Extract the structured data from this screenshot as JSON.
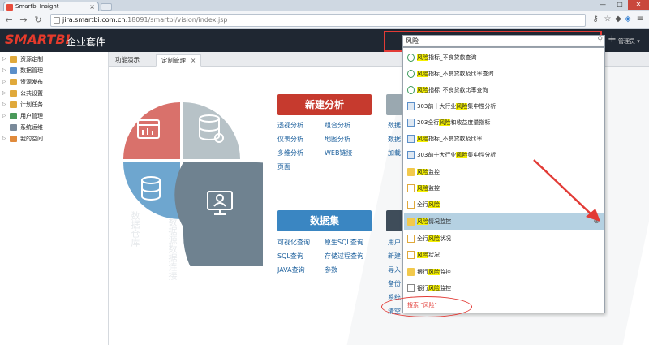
{
  "browser": {
    "tab_title": "Smartbi Insight",
    "tab_close": "×",
    "url_host": "jira.smartbi.com.cn",
    "url_path": ":18091/smartbi/vision/index.jsp",
    "win_minimize": "—",
    "win_maximize": "□",
    "win_close": "✕"
  },
  "header": {
    "logo": "SMARTBI",
    "suite": "企业套件",
    "search_value": "风险",
    "add_icon": "+",
    "user": "管理员 ▾"
  },
  "sidebar": {
    "items": [
      {
        "label": "资源定制",
        "color": "#e0a93b"
      },
      {
        "label": "数据管理",
        "color": "#5b8fc9"
      },
      {
        "label": "资源发布",
        "color": "#e0a93b"
      },
      {
        "label": "公共设置",
        "color": "#e0a93b"
      },
      {
        "label": "计划任务",
        "color": "#e0a93b"
      },
      {
        "label": "用户管理",
        "color": "#4a9a5a"
      },
      {
        "label": "系统运维",
        "color": "#7a8a9a"
      },
      {
        "label": "我的空间",
        "color": "#e08a3b"
      }
    ]
  },
  "tabs": [
    {
      "label": "功能演示",
      "active": false
    },
    {
      "label": "定制管理",
      "active": true,
      "close": "×"
    }
  ],
  "main": {
    "new_analysis": "新建分析",
    "new_analysis_links": [
      "透视分析",
      "组合分析",
      "仪表分析",
      "地图分析",
      "多维分析",
      "WEB链接",
      "页面"
    ],
    "dataset": "数据集",
    "dataset_links": [
      "可视化查询",
      "原生SQL查询",
      "SQL查询",
      "存储过程查询",
      "JAVA查询",
      "参数"
    ],
    "col3_top": [
      "数据",
      "数据",
      "加载"
    ],
    "col3_bottom": [
      "用户",
      "新建",
      "导入",
      "备份",
      "系统",
      "清空"
    ],
    "wm1": "数据仓库",
    "wm2": "数据源数据连接"
  },
  "dropdown": {
    "items": [
      {
        "pre": "",
        "hit": "风险",
        "post": "指标_不良贷款查询",
        "icon": "query"
      },
      {
        "pre": "",
        "hit": "风险",
        "post": "指标_不良贷款及比率查询",
        "icon": "query"
      },
      {
        "pre": "",
        "hit": "风险",
        "post": "指标_不良贷款比率查询",
        "icon": "query"
      },
      {
        "pre": "303前十大行业",
        "hit": "风险",
        "post": "集中性分析",
        "icon": "report"
      },
      {
        "pre": "203全行",
        "hit": "风险",
        "post": "和收益度量指标",
        "icon": "report"
      },
      {
        "pre": "",
        "hit": "风险",
        "post": "指标_不良贷款及比率",
        "icon": "report"
      },
      {
        "pre": "303前十大行业",
        "hit": "风险",
        "post": "集中性分析",
        "icon": "report"
      },
      {
        "pre": "",
        "hit": "风险",
        "post": "监控",
        "icon": "folder"
      },
      {
        "pre": "",
        "hit": "风险",
        "post": "监控",
        "icon": "page"
      },
      {
        "pre": "全行",
        "hit": "风险",
        "post": "",
        "icon": "page"
      },
      {
        "pre": "",
        "hit": "风险",
        "post": "情况监控",
        "icon": "folder",
        "highlight": true,
        "right": "⊕"
      },
      {
        "pre": "全行",
        "hit": "风险",
        "post": "状况",
        "icon": "page"
      },
      {
        "pre": "",
        "hit": "风险",
        "post": "状况",
        "icon": "page"
      },
      {
        "pre": "银行",
        "hit": "风险",
        "post": "监控",
        "icon": "folder"
      },
      {
        "pre": "银行",
        "hit": "风险",
        "post": "监控",
        "icon": "doc"
      }
    ],
    "search_all": "搜索 \"风险\""
  }
}
